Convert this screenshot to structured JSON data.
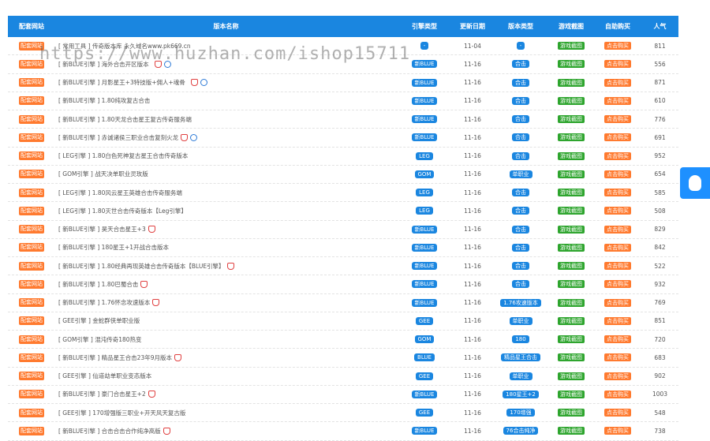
{
  "header": {
    "site": "配套网站",
    "name": "版本名称",
    "engine": "引擎类型",
    "date": "更新日期",
    "type": "版本类型",
    "detail": "游戏截图",
    "buy": "自助购买",
    "pop": "人气"
  },
  "watermark": "https://www.huzhan.com/ishop15711",
  "rows": [
    {
      "site": "配套网站",
      "title": "[ 常用工具 ] 传奇版本库 永久域名www.pk669.cn",
      "engine": "-",
      "date": "11-04",
      "type": "-",
      "detail": "游戏截图",
      "buy": "点击购买",
      "pop": "811",
      "icons": []
    },
    {
      "site": "配套网站",
      "title": "[ 新BLUE引擎 ] 海外合击开区版本",
      "engine": "新BLUE",
      "date": "11-16",
      "type": "合击",
      "detail": "游戏截图",
      "buy": "点击购买",
      "pop": "556",
      "icons": [
        "hot",
        "bag",
        "user"
      ]
    },
    {
      "site": "配套网站",
      "title": "[ 新BLUE引擎 ] 月影星王+3特技版+佣人+魂骨",
      "engine": "新BLUE",
      "date": "11-16",
      "type": "合击",
      "detail": "游戏截图",
      "buy": "点击购买",
      "pop": "871",
      "icons": [
        "hot",
        "bag",
        "user"
      ]
    },
    {
      "site": "配套网站",
      "title": "[ 新BLUE引擎 ] 1.80纯攻复古合击",
      "engine": "新BLUE",
      "date": "11-16",
      "type": "合击",
      "detail": "游戏截图",
      "buy": "点击购买",
      "pop": "610",
      "icons": []
    },
    {
      "site": "配套网站",
      "title": "[ 新BLUE引擎 ] 1.80天龙合击星王复古传奇服务端",
      "engine": "新BLUE",
      "date": "11-16",
      "type": "合击",
      "detail": "游戏截图",
      "buy": "点击购买",
      "pop": "776",
      "icons": []
    },
    {
      "site": "配套网站",
      "title": "[ 新BLUE引擎 ] 赤诚诸侯三职业合击复刻火龙",
      "engine": "新BLUE",
      "date": "11-16",
      "type": "合击",
      "detail": "游戏截图",
      "buy": "点击购买",
      "pop": "691",
      "icons": [
        "bag",
        "user"
      ]
    },
    {
      "site": "配套网站",
      "title": "[ LEG引擎 ] 1.80白色死神复古星王合击传奇版本",
      "engine": "LEG",
      "date": "11-16",
      "type": "合击",
      "detail": "游戏截图",
      "buy": "点击购买",
      "pop": "952",
      "icons": []
    },
    {
      "site": "配套网站",
      "title": "[ GOM引擎 ] 战天决单职业灵玫版",
      "engine": "GOM",
      "date": "11-16",
      "type": "单职业",
      "detail": "游戏截图",
      "buy": "点击购买",
      "pop": "654",
      "icons": []
    },
    {
      "site": "配套网站",
      "title": "[ LEG引擎 ] 1.80风云星王英雄合击传奇服务端",
      "engine": "LEG",
      "date": "11-16",
      "type": "合击",
      "detail": "游戏截图",
      "buy": "点击购买",
      "pop": "585",
      "icons": []
    },
    {
      "site": "配套网站",
      "title": "[ LEG引擎 ] 1.80灭世合击传奇版本【Leg引擎】",
      "engine": "LEG",
      "date": "11-16",
      "type": "合击",
      "detail": "游戏截图",
      "buy": "点击购买",
      "pop": "508",
      "icons": []
    },
    {
      "site": "配套网站",
      "title": "[ 新BLUE引擎 ] 昊天合击星王+3",
      "engine": "新BLUE",
      "date": "11-16",
      "type": "合击",
      "detail": "游戏截图",
      "buy": "点击购买",
      "pop": "829",
      "icons": [
        "bag"
      ]
    },
    {
      "site": "配套网站",
      "title": "[ 新BLUE引擎 ] 180星王+1开战合击版本",
      "engine": "新BLUE",
      "date": "11-16",
      "type": "合击",
      "detail": "游戏截图",
      "buy": "点击购买",
      "pop": "842",
      "icons": []
    },
    {
      "site": "配套网站",
      "title": "[ 新BLUE引擎 ] 1.80经典再现英雄合击传奇版本【BLUE引擎】",
      "engine": "新BLUE",
      "date": "11-16",
      "type": "合击",
      "detail": "游戏截图",
      "buy": "点击购买",
      "pop": "522",
      "icons": [
        "bag"
      ]
    },
    {
      "site": "配套网站",
      "title": "[ 新BLUE引擎 ] 1.80巴蜀合击",
      "engine": "新BLUE",
      "date": "11-16",
      "type": "合击",
      "detail": "游戏截图",
      "buy": "点击购买",
      "pop": "932",
      "icons": [
        "bag"
      ]
    },
    {
      "site": "配套网站",
      "title": "[ 新BLUE引擎 ] 1.76怀念攻速版本",
      "engine": "新BLUE",
      "date": "11-16",
      "type": "1.76攻速版本",
      "detail": "游戏截图",
      "buy": "点击购买",
      "pop": "769",
      "icons": [
        "bag"
      ]
    },
    {
      "site": "配套网站",
      "title": "[ GEE引擎 ] 金蛇群侠单职业版",
      "engine": "GEE",
      "date": "11-16",
      "type": "单职业",
      "detail": "游戏截图",
      "buy": "点击购买",
      "pop": "851",
      "icons": []
    },
    {
      "site": "配套网站",
      "title": "[ GOM引擎 ] 混沌传奇180热变",
      "engine": "GOM",
      "date": "11-16",
      "type": "180",
      "detail": "游戏截图",
      "buy": "点击购买",
      "pop": "720",
      "icons": []
    },
    {
      "site": "配套网站",
      "title": "[ 新BLUE引擎 ] 精品星王合击23年9月版本",
      "engine": "BLUE",
      "date": "11-16",
      "type": "精品星王合击",
      "detail": "游戏截图",
      "buy": "点击购买",
      "pop": "683",
      "icons": [
        "bag"
      ]
    },
    {
      "site": "配套网站",
      "title": "[ GEE引擎 ] 仙道劫单职业变态版本",
      "engine": "GEE",
      "date": "11-16",
      "type": "单职业",
      "detail": "游戏截图",
      "buy": "点击购买",
      "pop": "902",
      "icons": []
    },
    {
      "site": "配套网站",
      "title": "[ 新BLUE引擎 ] 豪门合击星王+2",
      "engine": "新BLUE",
      "date": "11-16",
      "type": "180星王+2",
      "detail": "游戏截图",
      "buy": "点击购买",
      "pop": "1003",
      "icons": [
        "bag"
      ]
    },
    {
      "site": "配套网站",
      "title": "[ GEE引擎 ] 170增强版三职业+开天风天复古版",
      "engine": "GEE",
      "date": "11-16",
      "type": "170增强",
      "detail": "游戏截图",
      "buy": "点击购买",
      "pop": "548",
      "icons": []
    },
    {
      "site": "配套网站",
      "title": "[ 新BLUE引擎 ] 合击合击合作纯净高版",
      "engine": "新BLUE",
      "date": "11-16",
      "type": "76合击纯净",
      "detail": "游戏截图",
      "buy": "点击购买",
      "pop": "738",
      "icons": [
        "bag"
      ]
    }
  ],
  "colors": {
    "header_bg": "#1a86e0",
    "site_btn": "#ff7a2f",
    "engine_badge": "#1a86e0",
    "detail_badge": "#2ea52e",
    "buy_badge": "#ff7a2f",
    "qq_bg": "#1e90ff"
  },
  "qq_icon": "qq-penguin-icon"
}
